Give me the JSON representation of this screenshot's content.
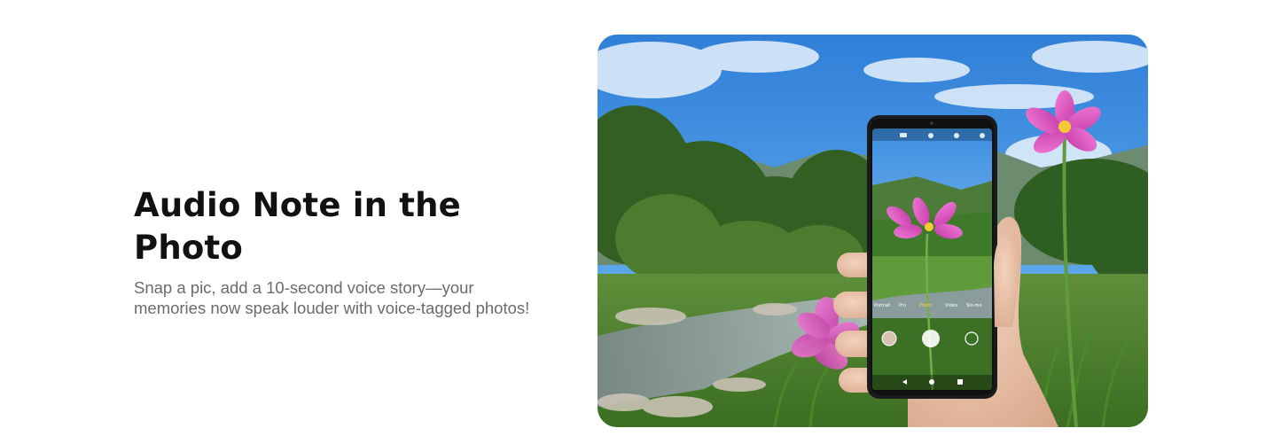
{
  "feature": {
    "title": "Audio Note in the Photo",
    "description_line1": "Snap a pic, add a 10-second voice story—your",
    "description_line2": "memories now speak louder with voice-tagged photos!"
  },
  "hero_image": {
    "camera_modes": [
      "Portrait",
      "Pro",
      "Photo",
      "Video",
      "Slo-mo"
    ],
    "colors": {
      "sky": "#3a8de0",
      "flower": "#e04fc0",
      "foliage": "#3f7a2a",
      "phone_frame": "#1b1b1d"
    }
  }
}
